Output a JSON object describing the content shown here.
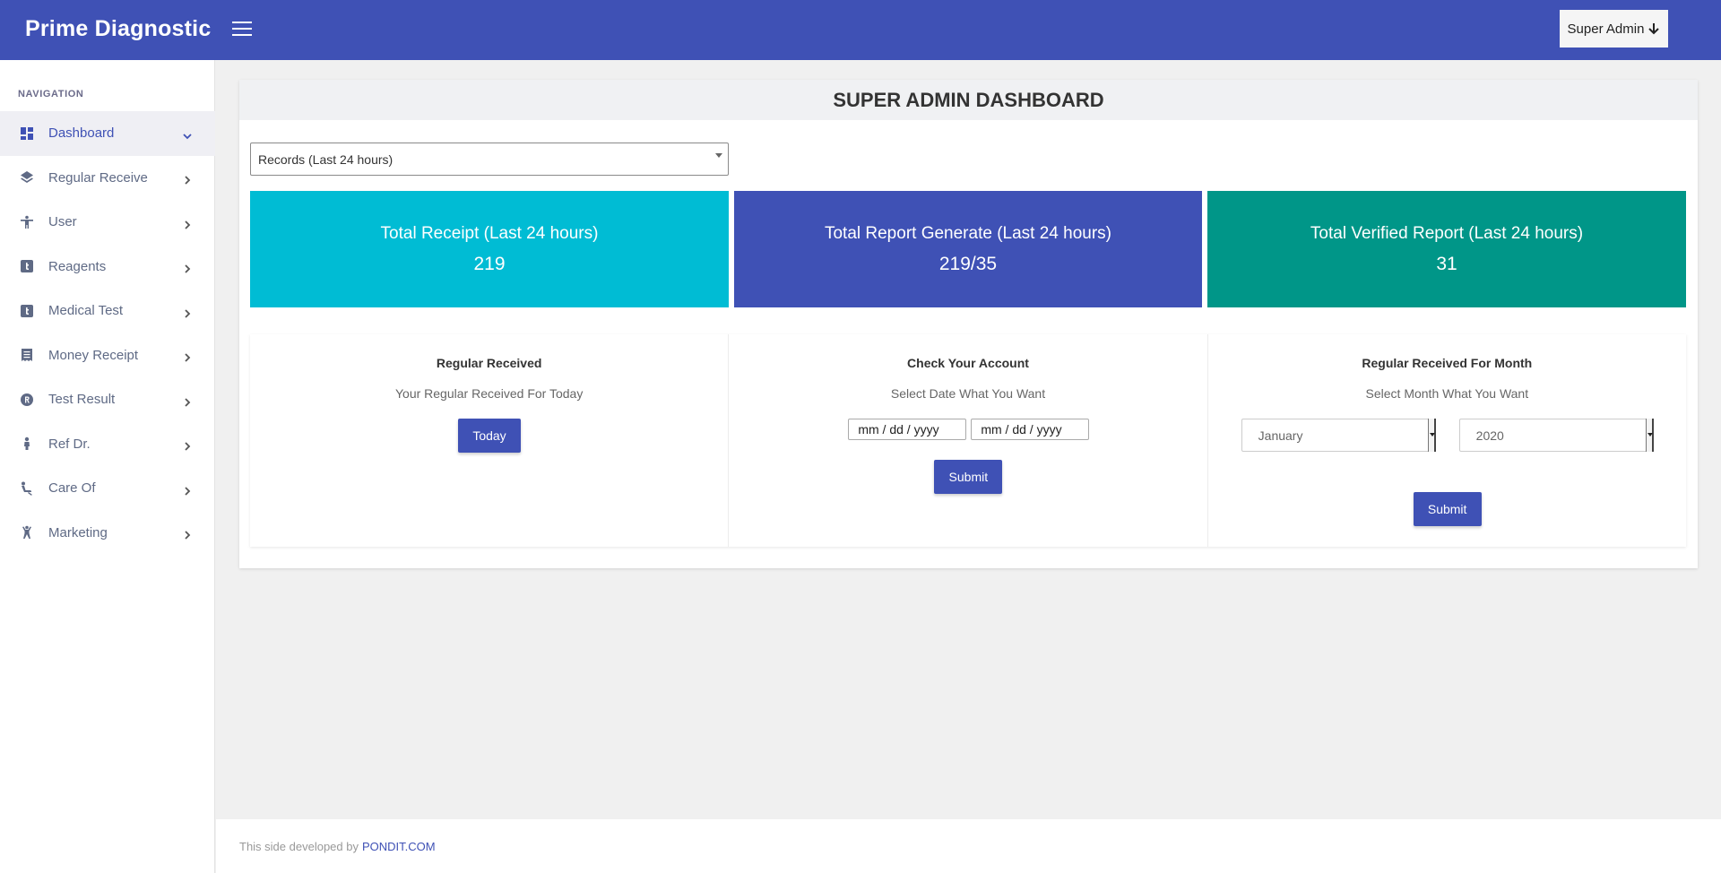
{
  "app": {
    "brand": "Prime Diagnostic",
    "user_menu_label": "Super Admin",
    "primary_color": "#3f51b5"
  },
  "sidebar": {
    "heading": "NAVIGATION",
    "items": [
      {
        "label": "Dashboard",
        "icon": "dashboard-icon",
        "active": true
      },
      {
        "label": "Regular Receive",
        "icon": "layers-icon"
      },
      {
        "label": "User",
        "icon": "accessibility-icon"
      },
      {
        "label": "Reagents",
        "icon": "tumblr-icon"
      },
      {
        "label": "Medical Test",
        "icon": "tumblr-icon"
      },
      {
        "label": "Money Receipt",
        "icon": "receipt-icon"
      },
      {
        "label": "Test Result",
        "icon": "registered-icon"
      },
      {
        "label": "Ref Dr.",
        "icon": "person-icon"
      },
      {
        "label": "Care Of",
        "icon": "seat-icon"
      },
      {
        "label": "Marketing",
        "icon": "human-icon"
      }
    ]
  },
  "dashboard": {
    "title": "SUPER ADMIN DASHBOARD",
    "records_select": "Records (Last 24 hours)",
    "stats": [
      {
        "title": "Total Receipt (Last 24 hours)",
        "value": "219",
        "color": "#00bcd4"
      },
      {
        "title": "Total Report Generate (Last 24 hours)",
        "value": "219/35",
        "color": "#3f51b5"
      },
      {
        "title": "Total Verified Report (Last 24 hours)",
        "value": "31",
        "color": "#009688"
      }
    ],
    "panels": {
      "regular": {
        "title": "Regular Received",
        "subtitle": "Your Regular Received For Today",
        "button": "Today"
      },
      "account": {
        "title": "Check Your Account",
        "subtitle": "Select Date What You Want",
        "date_from_placeholder": "mm / dd / yyyy",
        "date_to_placeholder": "mm / dd / yyyy",
        "button": "Submit"
      },
      "month": {
        "title": "Regular Received For Month",
        "subtitle": "Select Month What You Want",
        "month_value": "January",
        "year_value": "2020",
        "button": "Submit"
      }
    }
  },
  "footer": {
    "text": "This side developed by",
    "link": "PONDIT.COM"
  }
}
